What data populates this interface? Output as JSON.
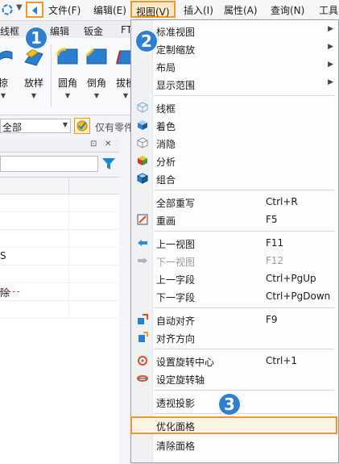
{
  "menubar": {
    "items": [
      {
        "label": "文件(F)"
      },
      {
        "label": "编辑(E)"
      },
      {
        "label": "视图(V)"
      },
      {
        "label": "插入(I)"
      },
      {
        "label": "属性(A)"
      },
      {
        "label": "查询(N)"
      },
      {
        "label": "工具"
      }
    ]
  },
  "tabs": [
    "线框",
    "编辑",
    "钣金",
    "FT"
  ],
  "ribbon": {
    "buttons": [
      {
        "label": "拉伸"
      },
      {
        "label": "放样"
      },
      {
        "label": "圆角"
      },
      {
        "label": "倒角"
      },
      {
        "label": "拔模"
      }
    ],
    "first_label_fragment": "掠"
  },
  "filter": {
    "scope_value": "全部",
    "select_only_label": "仅有零件"
  },
  "tree": {
    "rows": [
      "S",
      "除"
    ]
  },
  "badges": [
    "1",
    "2",
    "3"
  ],
  "view_menu": {
    "groups": [
      [
        {
          "label": "标准视图",
          "submenu": true,
          "icon": ""
        },
        {
          "label": "定制缩放",
          "submenu": true,
          "icon": ""
        },
        {
          "label": "布局",
          "submenu": true,
          "icon": ""
        },
        {
          "label": "显示范围",
          "submenu": true,
          "icon": ""
        }
      ],
      [
        {
          "label": "线框",
          "icon": "wireframe-cube-icon"
        },
        {
          "label": "着色",
          "icon": "shaded-cube-icon"
        },
        {
          "label": "消隐",
          "icon": "hidden-line-cube-icon"
        },
        {
          "label": "分析",
          "icon": "analysis-cube-icon"
        },
        {
          "label": "组合",
          "icon": "combined-cube-icon"
        }
      ],
      [
        {
          "label": "全部重写",
          "shortcut": "Ctrl+R",
          "icon": ""
        },
        {
          "label": "重画",
          "shortcut": "F5",
          "icon": "redraw-icon"
        }
      ],
      [
        {
          "label": "上一视图",
          "shortcut": "F11",
          "icon": "prev-view-icon"
        },
        {
          "label": "下一视图",
          "shortcut": "F12",
          "icon": "next-view-icon",
          "disabled": true
        },
        {
          "label": "上一字段",
          "shortcut": "Ctrl+PgUp",
          "icon": ""
        },
        {
          "label": "下一字段",
          "shortcut": "Ctrl+PgDown",
          "icon": ""
        }
      ],
      [
        {
          "label": "自动对齐",
          "shortcut": "F9",
          "icon": "auto-align-icon"
        },
        {
          "label": "对齐方向",
          "icon": "align-direction-icon"
        }
      ],
      [
        {
          "label": "设置旋转中心",
          "shortcut": "Ctrl+1",
          "icon": "rotation-center-icon"
        },
        {
          "label": "设定旋转轴",
          "icon": "rotation-axis-icon"
        }
      ],
      [
        {
          "label": "透视投影",
          "icon": ""
        }
      ],
      [
        {
          "label": "优化面格",
          "icon": "",
          "highlight": true
        },
        {
          "label": "清除面格",
          "icon": ""
        }
      ]
    ]
  },
  "colors": {
    "accent": "#f2952f",
    "badge": "#2e7fd0"
  }
}
